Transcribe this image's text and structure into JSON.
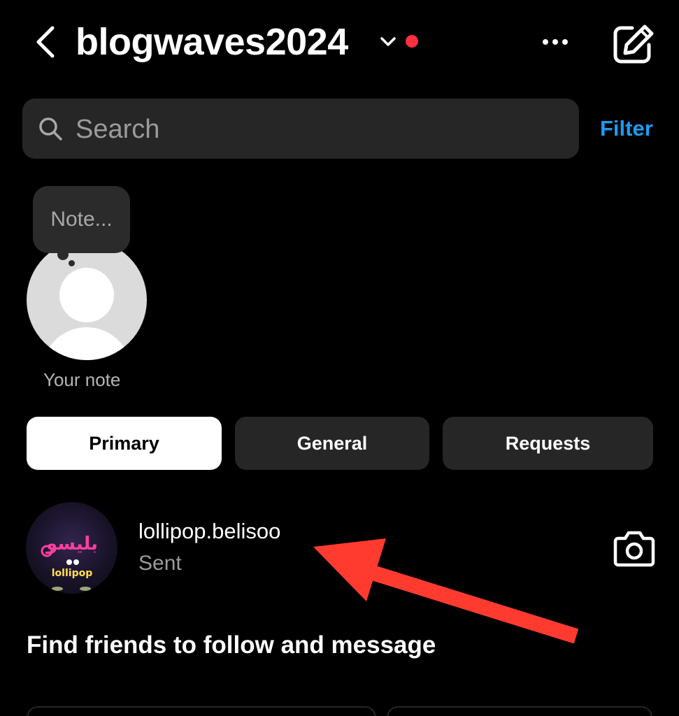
{
  "header": {
    "username": "blogwaves2024",
    "back_icon": "chevron-left-icon",
    "dropdown_icon": "chevron-down-icon",
    "more_icon": "more-horizontal-icon",
    "compose_icon": "edit-compose-icon",
    "dot_color": "#ff3040"
  },
  "search": {
    "placeholder": "Search",
    "filter_label": "Filter",
    "filter_color": "#1d9bf0"
  },
  "notes": {
    "bubble_text": "Note...",
    "label": "Your note"
  },
  "tabs": [
    {
      "label": "Primary",
      "selected": true
    },
    {
      "label": "General",
      "selected": false
    },
    {
      "label": "Requests",
      "selected": false
    }
  ],
  "conversations": [
    {
      "name": "lollipop.belisoo",
      "status": "Sent",
      "avatar_logo_text": "lollipop",
      "action_icon": "camera-icon"
    }
  ],
  "annotation": {
    "type": "arrow",
    "color": "#ff3b30"
  },
  "find_friends": {
    "heading": "Find friends to follow and message"
  }
}
